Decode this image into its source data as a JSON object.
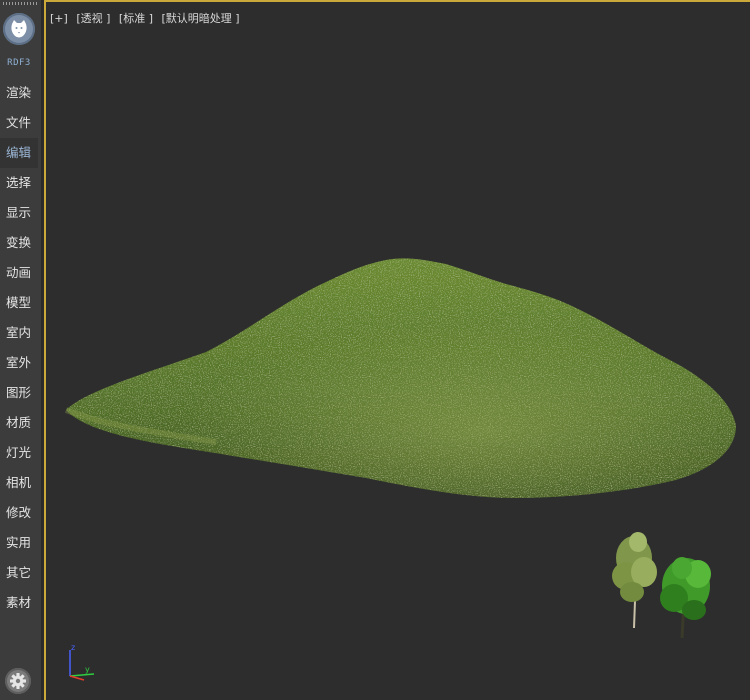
{
  "sidebar": {
    "version": "RDF3",
    "active_item": "编辑",
    "items": [
      {
        "label": "渲染"
      },
      {
        "label": "文件"
      },
      {
        "label": "编辑"
      },
      {
        "label": "选择"
      },
      {
        "label": "显示"
      },
      {
        "label": "变换"
      },
      {
        "label": "动画"
      },
      {
        "label": "模型"
      },
      {
        "label": "室内"
      },
      {
        "label": "室外"
      },
      {
        "label": "图形"
      },
      {
        "label": "材质"
      },
      {
        "label": "灯光"
      },
      {
        "label": "相机"
      },
      {
        "label": "修改"
      },
      {
        "label": "实用"
      },
      {
        "label": "其它"
      },
      {
        "label": "素材"
      }
    ]
  },
  "viewport": {
    "labels": {
      "plus": "[+]",
      "view": "[透视 ]",
      "shading": "[标准 ]",
      "lighting": "[默认明暗处理 ]"
    },
    "axes": {
      "z": "z",
      "y": "y"
    },
    "colors": {
      "border_active": "#caa93a",
      "background": "#2d2d2d",
      "terrain": "#5d7a2a",
      "axis_z": "#4a62ff",
      "axis_y": "#2ecc40",
      "axis_x": "#e53b2c"
    }
  }
}
